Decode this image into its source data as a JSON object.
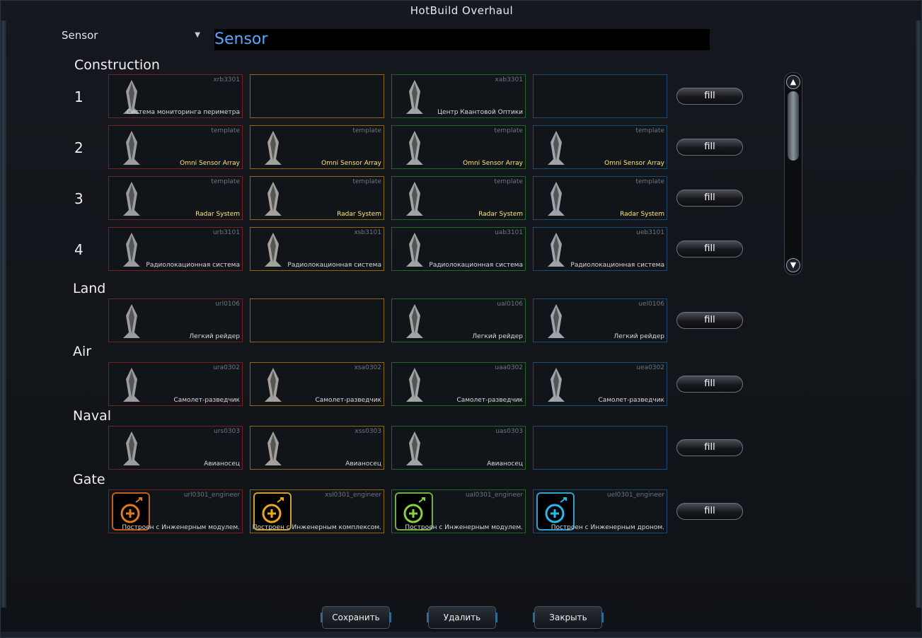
{
  "window": {
    "title": "HotBuild Overhaul"
  },
  "selector": {
    "value": "Sensor"
  },
  "name_field": {
    "value": "Sensor"
  },
  "fill_label": "fill",
  "sections": {
    "construction": {
      "title": "Construction",
      "rows": [
        {
          "num": "1",
          "cells": [
            {
              "code": "xrb3301",
              "label": "Система мониторинга периметра",
              "template": false,
              "empty": false
            },
            {
              "code": "",
              "label": "",
              "template": false,
              "empty": true
            },
            {
              "code": "xab3301",
              "label": "Центр Квантовой Оптики",
              "template": false,
              "empty": false
            },
            {
              "code": "",
              "label": "",
              "template": false,
              "empty": true
            }
          ]
        },
        {
          "num": "2",
          "cells": [
            {
              "code": "template",
              "label": "Omni Sensor Array",
              "template": true,
              "empty": false
            },
            {
              "code": "template",
              "label": "Omni Sensor Array",
              "template": true,
              "empty": false
            },
            {
              "code": "template",
              "label": "Omni Sensor Array",
              "template": true,
              "empty": false
            },
            {
              "code": "template",
              "label": "Omni Sensor Array",
              "template": true,
              "empty": false
            }
          ]
        },
        {
          "num": "3",
          "cells": [
            {
              "code": "template",
              "label": "Radar System",
              "template": true,
              "empty": false
            },
            {
              "code": "template",
              "label": "Radar System",
              "template": true,
              "empty": false
            },
            {
              "code": "template",
              "label": "Radar System",
              "template": true,
              "empty": false
            },
            {
              "code": "template",
              "label": "Radar System",
              "template": true,
              "empty": false
            }
          ]
        },
        {
          "num": "4",
          "cells": [
            {
              "code": "urb3101",
              "label": "Радиолокационная система",
              "template": false,
              "empty": false
            },
            {
              "code": "xsb3101",
              "label": "Радиолокационная система",
              "template": false,
              "empty": false
            },
            {
              "code": "uab3101",
              "label": "Радиолокационная система",
              "template": false,
              "empty": false
            },
            {
              "code": "ueb3101",
              "label": "Радиолокационная система",
              "template": false,
              "empty": false
            }
          ]
        }
      ]
    },
    "land": {
      "title": "Land",
      "cells": [
        {
          "code": "url0106",
          "label": "Легкий рейдер",
          "empty": false
        },
        {
          "code": "",
          "label": "",
          "empty": true
        },
        {
          "code": "ual0106",
          "label": "Легкий рейдер",
          "empty": false
        },
        {
          "code": "uel0106",
          "label": "Легкий рейдер",
          "empty": false
        }
      ]
    },
    "air": {
      "title": "Air",
      "cells": [
        {
          "code": "ura0302",
          "label": "Самолет-разведчик",
          "empty": false
        },
        {
          "code": "xsa0302",
          "label": "Самолет-разведчик",
          "empty": false
        },
        {
          "code": "uaa0302",
          "label": "Самолет-разведчик",
          "empty": false
        },
        {
          "code": "uea0302",
          "label": "Самолет-разведчик",
          "empty": false
        }
      ]
    },
    "naval": {
      "title": "Naval",
      "cells": [
        {
          "code": "urs0303",
          "label": "Авианосец",
          "empty": false
        },
        {
          "code": "xss0303",
          "label": "Авианосец",
          "empty": false
        },
        {
          "code": "uas0303",
          "label": "Авианосец",
          "empty": false
        },
        {
          "code": "",
          "label": "",
          "empty": true
        }
      ]
    },
    "gate": {
      "title": "Gate",
      "cells": [
        {
          "code": "url0301_engineer",
          "label": "Построен с Инженерным модулем.",
          "empty": false
        },
        {
          "code": "xsl0301_engineer",
          "label": "Построен с Инженерным комплексом.",
          "empty": false
        },
        {
          "code": "ual0301_engineer",
          "label": "Построен с Инженерным модулем.",
          "empty": false
        },
        {
          "code": "uel0301_engineer",
          "label": "Построен с Инженерным дроном.",
          "empty": false
        }
      ]
    }
  },
  "buttons": {
    "save": "Сохранить",
    "delete": "Удалить",
    "close": "Закрыть"
  },
  "colors": {
    "cybran": "#7a1e1e",
    "seraphim": "#8a6a10",
    "aeon": "#1f6a22",
    "uef": "#1d4a70",
    "name_text": "#5aa9ff",
    "template_text": "#ffe96a"
  }
}
